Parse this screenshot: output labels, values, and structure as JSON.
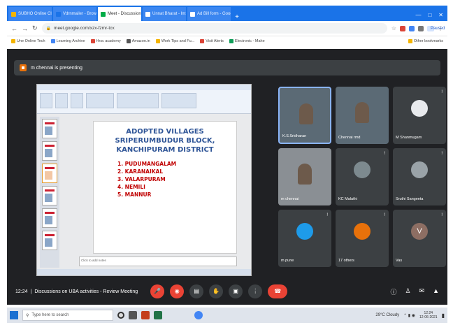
{
  "browser": {
    "tabs": [
      {
        "label": "SUBHO Online Classes",
        "color": "#f4b400",
        "active": false
      },
      {
        "label": "Vdrnmailer - Browser",
        "color": "#1a73e8",
        "active": false
      },
      {
        "label": "Meet - Discussion",
        "color": "#00ac47",
        "active": true
      },
      {
        "label": "Unnat Bharat - Imsai",
        "color": "#ffffff",
        "active": false
      },
      {
        "label": "Ad Bill form - Google",
        "color": "#ffffff",
        "active": false
      }
    ],
    "new_tab": "+",
    "url": "meet.google.com/xzx-fzmr-tcx",
    "profile": "Paused",
    "bookmarks": [
      {
        "label": "Une Online Tech",
        "color": "#f4b400"
      },
      {
        "label": "Learning Archive",
        "color": "#4285f4"
      },
      {
        "label": "Hrsc academy",
        "color": "#db4437"
      },
      {
        "label": "Amazon.in",
        "color": "#555555"
      },
      {
        "label": "Work Tips and Fu...",
        "color": "#f4b400"
      },
      {
        "label": "Visit Alerts",
        "color": "#db4437"
      },
      {
        "label": "Electronic - Mahe",
        "color": "#0f9d58"
      },
      {
        "label": "Other bookmarks",
        "color": "#f4b400"
      }
    ]
  },
  "meet": {
    "presenter_banner": "m chennai is presenting",
    "slide": {
      "title_lines": [
        "ADOPTED VILLAGES",
        "SRIPERUMBUDUR BLOCK,",
        "KANCHIPURAM DISTRICT"
      ],
      "items": [
        "1. PUDUMANGALAM",
        "2. KARANAIKAL",
        "3. VALARPURAM",
        "4. NEMILI",
        "5. MANNUR"
      ],
      "notes_placeholder": "Click to add notes"
    },
    "participants": [
      {
        "name": "K.S.Sridharan",
        "type": "video",
        "pinned": true
      },
      {
        "name": "Chennai rmd",
        "type": "video",
        "pinned": false
      },
      {
        "name": "M Shanmugam",
        "type": "avatar",
        "avatar_color": "#e8eaed"
      },
      {
        "name": "m chennai",
        "type": "video",
        "pinned": false
      },
      {
        "name": "KC Malathi",
        "type": "avatar",
        "avatar_color": "#7d8a8f"
      },
      {
        "name": "Sruthi Sangeeta",
        "type": "avatar",
        "avatar_color": "#9aa3a8"
      },
      {
        "name": "m pune",
        "type": "avatar",
        "avatar_color": "#1e9be9"
      },
      {
        "name": "17 others",
        "type": "others",
        "avatar_color": "#e8710a"
      },
      {
        "name": "Vas",
        "type": "avatar",
        "avatar_color": "#8d6e63",
        "initial": "V"
      }
    ],
    "mic_symbol": " !",
    "bottom": {
      "time": "12:24",
      "meeting_title": "Discussions on UBA activities - Review Meeting"
    }
  },
  "taskbar": {
    "search_placeholder": "Type here to search",
    "weather": "29°C Cloudy",
    "time": "12:24",
    "date": "12-06-2021"
  }
}
